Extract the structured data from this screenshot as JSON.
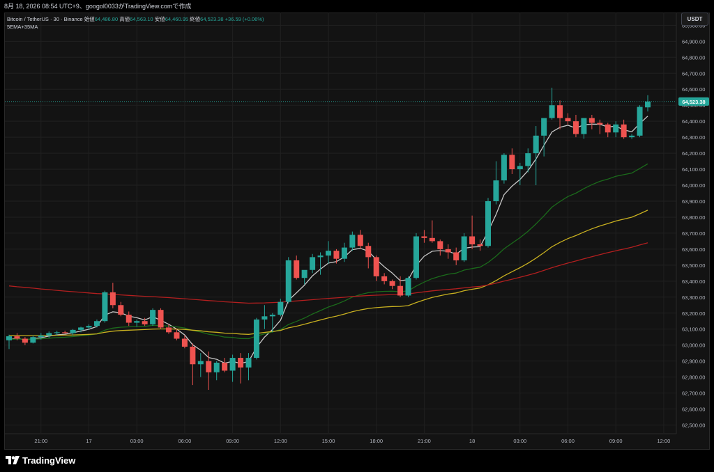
{
  "top_bar": {
    "text": "8月 18, 2026 08:54 UTC+9、googol0033がTradingView.comで作成"
  },
  "legend": {
    "symbol": "Bitcoin / TetherUS · 30 · Binance",
    "open_label": "始値",
    "open_value": "64,486.80",
    "high_label": "高値",
    "high_value": "64,563.10",
    "low_label": "安値",
    "low_value": "64,460.95",
    "close_label": "終値",
    "close_value": "64,523.38",
    "change_value": "+36.59 (+0.06%)",
    "indicator": "5EMA+35MA"
  },
  "currency_button": "USDT",
  "footer": {
    "brand": "TradingView"
  },
  "colors": {
    "up": "#26a69a",
    "down": "#ef5350",
    "ema_white": "#c8c8c8",
    "ma_green": "#1b6b1b",
    "ma_yellow": "#c8b020",
    "ma_red": "#b21f1f",
    "grid": "#202020"
  },
  "chart_data": {
    "type": "candlestick",
    "interval": "30",
    "ylim": [
      62450,
      65080
    ],
    "y_ticks": [
      62500,
      62600,
      62700,
      62800,
      62900,
      63000,
      63100,
      63200,
      63300,
      63400,
      63500,
      63600,
      63700,
      63800,
      63900,
      64000,
      64100,
      64200,
      64300,
      64400,
      64500,
      64600,
      64700,
      64800,
      64900,
      65000
    ],
    "y_tick_labels": [
      "62,500.00",
      "62,600.00",
      "62,700.00",
      "62,800.00",
      "62,900.00",
      "63,000.00",
      "63,100.00",
      "63,200.00",
      "63,300.00",
      "63,400.00",
      "63,500.00",
      "63,600.00",
      "63,700.00",
      "63,800.00",
      "63,900.00",
      "64,000.00",
      "64,100.00",
      "64,200.00",
      "64,300.00",
      "64,400.00",
      "64,500.00",
      "64,600.00",
      "64,700.00",
      "64,800.00",
      "64,900.00",
      "65,000.00"
    ],
    "x_ticks": [
      {
        "bar": 4,
        "label": "21:00"
      },
      {
        "bar": 10,
        "label": "17"
      },
      {
        "bar": 16,
        "label": "03:00"
      },
      {
        "bar": 22,
        "label": "06:00"
      },
      {
        "bar": 28,
        "label": "09:00"
      },
      {
        "bar": 34,
        "label": "12:00"
      },
      {
        "bar": 40,
        "label": "15:00"
      },
      {
        "bar": 46,
        "label": "18:00"
      },
      {
        "bar": 52,
        "label": "21:00"
      },
      {
        "bar": 58,
        "label": "18"
      },
      {
        "bar": 64,
        "label": "03:00"
      },
      {
        "bar": 70,
        "label": "06:00"
      },
      {
        "bar": 76,
        "label": "09:00"
      },
      {
        "bar": 82,
        "label": "12:00"
      }
    ],
    "last_price": 64523.38,
    "last_price_label": "64,523.38",
    "candles": [
      [
        63030,
        63065,
        62975,
        63055
      ],
      [
        63055,
        63075,
        63030,
        63040
      ],
      [
        63040,
        63050,
        63000,
        63015
      ],
      [
        63015,
        63060,
        63010,
        63050
      ],
      [
        63050,
        63075,
        63035,
        63060
      ],
      [
        63060,
        63085,
        63045,
        63075
      ],
      [
        63075,
        63090,
        63060,
        63080
      ],
      [
        63080,
        63090,
        63070,
        63075
      ],
      [
        63075,
        63100,
        63060,
        63095
      ],
      [
        63095,
        63115,
        63080,
        63110
      ],
      [
        63110,
        63130,
        63095,
        63120
      ],
      [
        63120,
        63160,
        63110,
        63150
      ],
      [
        63150,
        63340,
        63140,
        63330
      ],
      [
        63330,
        63390,
        63230,
        63250
      ],
      [
        63250,
        63270,
        63180,
        63190
      ],
      [
        63190,
        63210,
        63120,
        63140
      ],
      [
        63140,
        63160,
        63115,
        63150
      ],
      [
        63150,
        63170,
        63120,
        63130
      ],
      [
        63130,
        63230,
        63120,
        63220
      ],
      [
        63220,
        63230,
        63100,
        63110
      ],
      [
        63110,
        63130,
        63070,
        63080
      ],
      [
        63080,
        63100,
        63030,
        63040
      ],
      [
        63040,
        63060,
        62980,
        62990
      ],
      [
        62990,
        63010,
        62750,
        62880
      ],
      [
        62880,
        62950,
        62800,
        62900
      ],
      [
        62900,
        62960,
        62720,
        62830
      ],
      [
        62830,
        62900,
        62780,
        62890
      ],
      [
        62890,
        62920,
        62830,
        62840
      ],
      [
        62840,
        62940,
        62770,
        62920
      ],
      [
        62920,
        62950,
        62760,
        62860
      ],
      [
        62860,
        62950,
        62780,
        62920
      ],
      [
        62920,
        63170,
        62910,
        63160
      ],
      [
        63160,
        63250,
        63100,
        63180
      ],
      [
        63180,
        63200,
        63080,
        63190
      ],
      [
        63190,
        63290,
        63180,
        63270
      ],
      [
        63270,
        63550,
        63260,
        63530
      ],
      [
        63530,
        63560,
        63410,
        63420
      ],
      [
        63420,
        63460,
        63380,
        63470
      ],
      [
        63470,
        63570,
        63450,
        63550
      ],
      [
        63550,
        63580,
        63440,
        63560
      ],
      [
        63560,
        63650,
        63510,
        63590
      ],
      [
        63590,
        63600,
        63510,
        63540
      ],
      [
        63540,
        63640,
        63520,
        63610
      ],
      [
        63610,
        63710,
        63590,
        63690
      ],
      [
        63690,
        63720,
        63600,
        63620
      ],
      [
        63620,
        63640,
        63480,
        63550
      ],
      [
        63550,
        63560,
        63400,
        63430
      ],
      [
        63430,
        63450,
        63380,
        63400
      ],
      [
        63400,
        63410,
        63350,
        63370
      ],
      [
        63370,
        63430,
        63300,
        63310
      ],
      [
        63310,
        63430,
        63300,
        63420
      ],
      [
        63420,
        63700,
        63410,
        63680
      ],
      [
        63680,
        63720,
        63640,
        63670
      ],
      [
        63670,
        63780,
        63640,
        63650
      ],
      [
        63650,
        63660,
        63560,
        63600
      ],
      [
        63600,
        63630,
        63540,
        63580
      ],
      [
        63580,
        63610,
        63500,
        63530
      ],
      [
        63530,
        63700,
        63520,
        63680
      ],
      [
        63680,
        63810,
        63600,
        63630
      ],
      [
        63630,
        63660,
        63590,
        63620
      ],
      [
        63620,
        63920,
        63610,
        63900
      ],
      [
        63900,
        64150,
        63880,
        64030
      ],
      [
        64030,
        64200,
        64010,
        64190
      ],
      [
        64190,
        64230,
        64070,
        64100
      ],
      [
        64100,
        64140,
        64000,
        64120
      ],
      [
        64120,
        64230,
        64080,
        64200
      ],
      [
        64200,
        64370,
        64000,
        64310
      ],
      [
        64310,
        64330,
        64180,
        64420
      ],
      [
        64420,
        64610,
        64410,
        64500
      ],
      [
        64500,
        64530,
        64350,
        64420
      ],
      [
        64420,
        64450,
        64380,
        64400
      ],
      [
        64400,
        64440,
        64300,
        64320
      ],
      [
        64320,
        64420,
        64290,
        64420
      ],
      [
        64420,
        64440,
        64350,
        64390
      ],
      [
        64390,
        64410,
        64320,
        64380
      ],
      [
        64380,
        64390,
        64300,
        64330
      ],
      [
        64330,
        64400,
        64300,
        64380
      ],
      [
        64380,
        64410,
        64290,
        64300
      ],
      [
        64300,
        64320,
        64290,
        64310
      ],
      [
        64310,
        64500,
        64300,
        64490
      ],
      [
        64486.8,
        64563.1,
        64460.95,
        64523.38
      ]
    ],
    "series": [
      {
        "name": "EMA(5)",
        "color": "#c8c8c8",
        "values": [
          63035,
          63042,
          63033,
          63039,
          63046,
          63056,
          63064,
          63068,
          63077,
          63088,
          63099,
          63116,
          63187,
          63208,
          63202,
          63181,
          63171,
          63157,
          63178,
          63155,
          63130,
          63100,
          63063,
          63002,
          62968,
          62922,
          62911,
          62887,
          62898,
          62885,
          62897,
          62985,
          63050,
          63097,
          63155,
          63280,
          63327,
          63375,
          63433,
          63475,
          63513,
          63522,
          63551,
          63597,
          63605,
          63587,
          63535,
          63490,
          63450,
          63403,
          63409,
          63499,
          63556,
          63587,
          63591,
          63587,
          63568,
          63605,
          63613,
          63615,
          63710,
          63817,
          63941,
          63994,
          64036,
          64091,
          64164,
          64249,
          64333,
          64362,
          64375,
          64357,
          64378,
          64382,
          64381,
          64364,
          64369,
          64346,
          64334,
          64386,
          64432
        ]
      },
      {
        "name": "MA(35) 緑",
        "color": "#1b6b1b",
        "values": [
          63035,
          63038,
          63036,
          63037,
          63039,
          63043,
          63047,
          63049,
          63053,
          63058,
          63063,
          63070,
          63093,
          63106,
          63112,
          63114,
          63116,
          63117,
          63123,
          63122,
          63119,
          63114,
          63107,
          63092,
          63082,
          63068,
          63061,
          63050,
          63048,
          63041,
          63040,
          63056,
          63070,
          63082,
          63097,
          63129,
          63148,
          63169,
          63194,
          63216,
          63238,
          63255,
          63276,
          63300,
          63316,
          63328,
          63333,
          63336,
          63337,
          63334,
          63339,
          63369,
          63394,
          63416,
          63431,
          63443,
          63450,
          63469,
          63479,
          63487,
          63517,
          63556,
          63602,
          63637,
          63672,
          63712,
          63758,
          63808,
          63863,
          63898,
          63929,
          63950,
          63979,
          64003,
          64024,
          64038,
          64056,
          64066,
          64076,
          64104,
          64134
        ]
      },
      {
        "name": "MA 黄",
        "color": "#c8b020",
        "values": [
          63060,
          63060,
          63059,
          63059,
          63059,
          63060,
          63061,
          63062,
          63063,
          63065,
          63067,
          63070,
          63080,
          63087,
          63091,
          63093,
          63095,
          63097,
          63100,
          63101,
          63101,
          63100,
          63098,
          63093,
          63089,
          63083,
          63080,
          63075,
          63073,
          63069,
          63067,
          63073,
          63079,
          63085,
          63092,
          63108,
          63118,
          63130,
          63144,
          63157,
          63170,
          63181,
          63194,
          63209,
          63220,
          63229,
          63234,
          63238,
          63241,
          63242,
          63247,
          63266,
          63283,
          63298,
          63309,
          63319,
          63326,
          63340,
          63349,
          63357,
          63377,
          63403,
          63433,
          63459,
          63484,
          63512,
          63544,
          63578,
          63615,
          63642,
          63666,
          63685,
          63707,
          63727,
          63745,
          63760,
          63776,
          63788,
          63800,
          63821,
          63844
        ]
      },
      {
        "name": "MA 赤",
        "color": "#b21f1f",
        "values": [
          63370,
          63365,
          63361,
          63356,
          63351,
          63347,
          63342,
          63338,
          63334,
          63330,
          63326,
          63322,
          63320,
          63317,
          63314,
          63311,
          63308,
          63305,
          63303,
          63300,
          63297,
          63293,
          63290,
          63286,
          63282,
          63278,
          63275,
          63271,
          63268,
          63265,
          63262,
          63263,
          63264,
          63266,
          63268,
          63273,
          63276,
          63280,
          63284,
          63288,
          63292,
          63295,
          63299,
          63304,
          63307,
          63310,
          63312,
          63314,
          63316,
          63317,
          63320,
          63327,
          63333,
          63339,
          63344,
          63348,
          63352,
          63358,
          63363,
          63367,
          63376,
          63387,
          63400,
          63412,
          63424,
          63437,
          63451,
          63467,
          63484,
          63499,
          63513,
          63526,
          63540,
          63553,
          63566,
          63578,
          63590,
          63601,
          63612,
          63626,
          63640
        ]
      }
    ]
  }
}
